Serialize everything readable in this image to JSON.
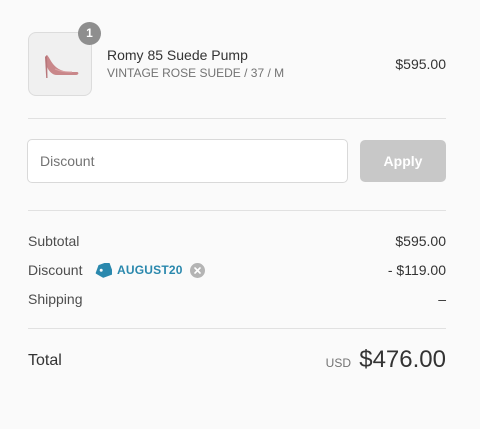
{
  "product": {
    "quantity": "1",
    "name": "Romy 85 Suede Pump",
    "variant": "VINTAGE ROSE SUEDE / 37 / M",
    "price": "$595.00",
    "image_icon": "pink-pump-shoe"
  },
  "discount": {
    "placeholder": "Discount",
    "value": "",
    "apply_label": "Apply"
  },
  "summary": {
    "subtotal_label": "Subtotal",
    "subtotal_value": "$595.00",
    "discount_label": "Discount",
    "discount_code": "AUGUST20",
    "discount_icon": "tag-icon",
    "discount_value": "- $119.00",
    "shipping_label": "Shipping",
    "shipping_value": "–"
  },
  "total": {
    "label": "Total",
    "currency": "USD",
    "amount": "$476.00"
  },
  "colors": {
    "accent": "#2a88ad",
    "button_disabled": "#c8c8c8",
    "badge": "#8e8e8e",
    "background": "#fafafa",
    "shoe": "#c9878a"
  }
}
